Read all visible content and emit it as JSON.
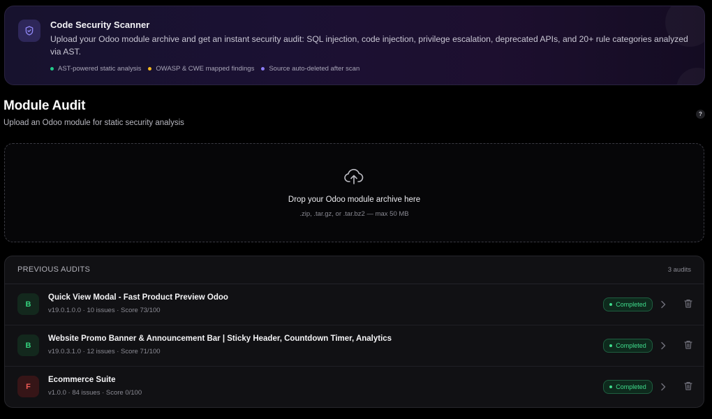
{
  "hero": {
    "title": "Code Security Scanner",
    "description": "Upload your Odoo module archive and get an instant security audit: SQL injection, code injection, privilege escalation, deprecated APIs, and 20+ rule categories analyzed via AST.",
    "icon": "shield-check-icon",
    "features": [
      {
        "label": "AST-powered static analysis",
        "color": "#22c98a"
      },
      {
        "label": "OWASP & CWE mapped findings",
        "color": "#f5b820"
      },
      {
        "label": "Source auto-deleted after scan",
        "color": "#8b7cf6"
      }
    ]
  },
  "page": {
    "title": "Module Audit",
    "subtitle": "Upload an Odoo module for static security analysis",
    "help_label": "?"
  },
  "dropzone": {
    "icon": "cloud-upload-icon",
    "title": "Drop your Odoo module archive here",
    "hint": ".zip, .tar.gz, or .tar.bz2 — max 50 MB"
  },
  "audits": {
    "title": "PREVIOUS AUDITS",
    "count": "3 audits",
    "rows": [
      {
        "grade": "B",
        "name": "Quick View Modal - Fast Product Preview Odoo",
        "meta": "v19.0.1.0.0 · 10 issues · Score 73/100",
        "status": "Completed"
      },
      {
        "grade": "B",
        "name": "Website Promo Banner & Announcement Bar | Sticky Header, Countdown Timer, Analytics",
        "meta": "v19.0.3.1.0 · 12 issues · Score 71/100",
        "status": "Completed"
      },
      {
        "grade": "F",
        "name": "Ecommerce Suite",
        "meta": "v1.0.0 · 84 issues · Score 0/100",
        "status": "Completed"
      }
    ]
  },
  "colors": {
    "accent": "#8b7cf6",
    "success": "#3fdc8c",
    "grade_b": "#34d17d",
    "grade_f": "#ef5a55"
  }
}
